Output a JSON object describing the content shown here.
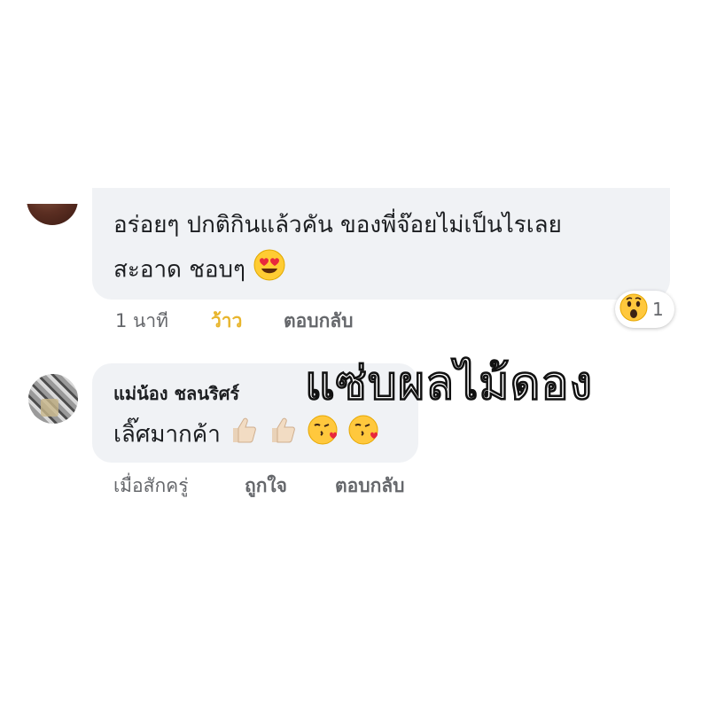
{
  "comments": [
    {
      "text_line1": "อร่อยๆ ปกติกินแล้วคัน ของพี่จ๊อยไม่เป็นไรเลย",
      "text_line2": "สะอาด ชอบๆ",
      "actions": {
        "time": "1 นาที",
        "like": "ว้าว",
        "reply": "ตอบกลับ"
      },
      "reaction": {
        "icon": "wow-reaction-icon",
        "count": "1"
      }
    },
    {
      "author": "แม่น้อง ชลนริศร์",
      "text": "เลิ๊ศมากค้า",
      "actions": {
        "time": "เมื่อสักครู่",
        "like": "ถูกใจ",
        "reply": "ตอบกลับ"
      }
    }
  ],
  "overlay_caption": "แซ่บผลไม้ดอง",
  "colors": {
    "bubble": "#f0f2f5",
    "muted": "#65676b",
    "wow_like": "#e8b52c"
  }
}
